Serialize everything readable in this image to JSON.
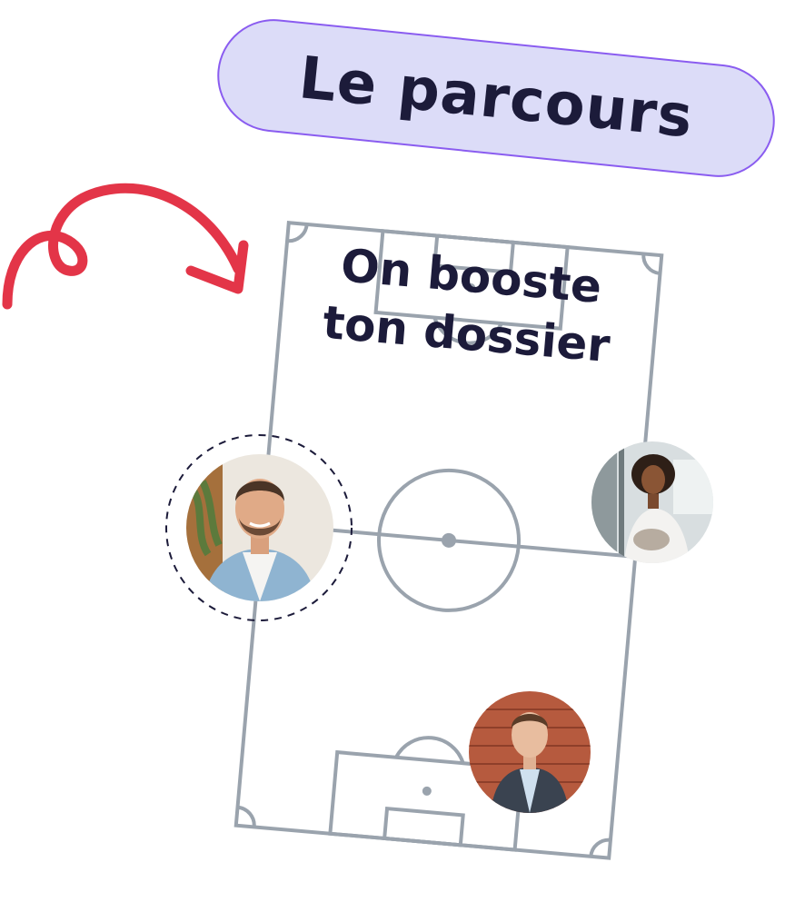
{
  "header": {
    "pill_label": "Le parcours"
  },
  "field": {
    "title_line1": "On booste",
    "title_line2": "ton dossier"
  },
  "colors": {
    "pill_fill": "#dcdcf8",
    "pill_border": "#8a5cf0",
    "text_dark": "#1c1b3a",
    "field_lines": "#9aa3ad",
    "arrow": "#e33548"
  },
  "icons": {
    "arrow": "curly-arrow-icon",
    "avatars": [
      "avatar-man-denim",
      "avatar-woman-office",
      "avatar-man-suit"
    ]
  }
}
